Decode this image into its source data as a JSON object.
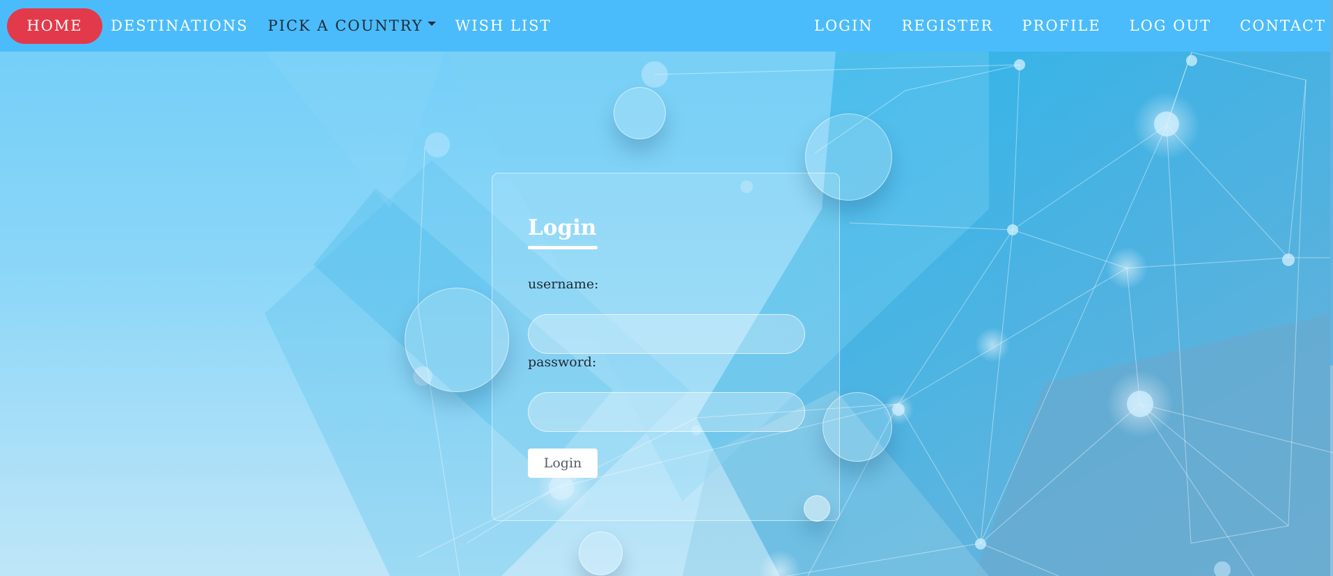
{
  "nav": {
    "home": "HOME",
    "destinations": "DESTINATIONS",
    "pick_country": "PICK A COUNTRY",
    "wish_list": "WISH LIST",
    "login": "LOGIN",
    "register": "REGISTER",
    "profile": "PROFILE",
    "logout": "LOG OUT",
    "contact": "CONTACT"
  },
  "login_form": {
    "title": "Login",
    "username_label": "username:",
    "username_value": "",
    "password_label": "password:",
    "password_value": "",
    "submit_label": "Login"
  },
  "colors": {
    "navbar": "#4bbcfb",
    "home_active": "#e23a4b",
    "text_light": "#ffffff"
  }
}
